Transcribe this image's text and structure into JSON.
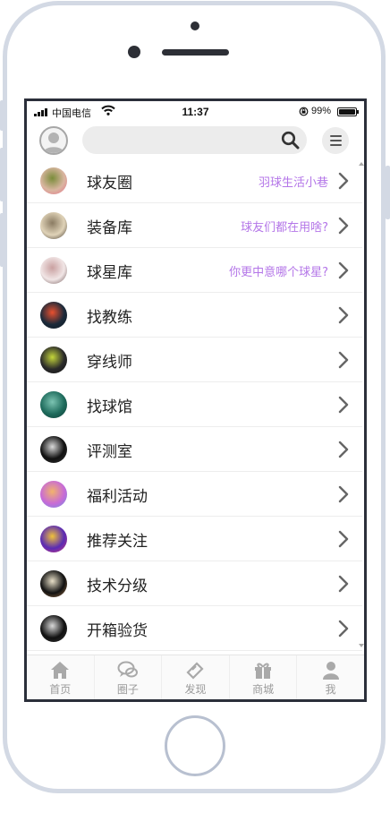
{
  "status_bar": {
    "carrier": "中国电信",
    "time": "11:37",
    "battery": "99%",
    "battery_level": 0.99
  },
  "header": {
    "search_placeholder": ""
  },
  "list": [
    {
      "label": "球友圈",
      "subtitle": "羽球生活小巷",
      "avatar_icon": "flowers-avatar",
      "avatar_colors": [
        "#d9b6a0",
        "#7a8c3a",
        "#e6708c"
      ]
    },
    {
      "label": "装备库",
      "subtitle": "球友们都在用啥?",
      "avatar_icon": "portrait-avatar",
      "avatar_colors": [
        "#e0d3b8",
        "#8a7b62",
        "#3a3128"
      ]
    },
    {
      "label": "球星库",
      "subtitle": "你更中意哪个球星?",
      "avatar_icon": "girl-avatar",
      "avatar_colors": [
        "#f1e6e6",
        "#c9a0a0",
        "#6b5252"
      ]
    },
    {
      "label": "找教练",
      "subtitle": "",
      "avatar_icon": "sunset-avatar",
      "avatar_colors": [
        "#1b2a3a",
        "#e9502f",
        "#0f1822"
      ]
    },
    {
      "label": "穿线师",
      "subtitle": "",
      "avatar_icon": "car-avatar",
      "avatar_colors": [
        "#2a2a2a",
        "#c4d63a",
        "#111111"
      ]
    },
    {
      "label": "找球馆",
      "subtitle": "",
      "avatar_icon": "ocean-avatar",
      "avatar_colors": [
        "#1e6b5c",
        "#7cc4b2",
        "#0e3a34"
      ]
    },
    {
      "label": "评测室",
      "subtitle": "",
      "avatar_icon": "arch-avatar",
      "avatar_colors": [
        "#111111",
        "#d9d9d9",
        "#333333"
      ]
    },
    {
      "label": "福利活动",
      "subtitle": "",
      "avatar_icon": "nebula-avatar",
      "avatar_colors": [
        "#c86bd6",
        "#f2b36b",
        "#6b8fe6"
      ]
    },
    {
      "label": "推荐关注",
      "subtitle": "",
      "avatar_icon": "abstract-avatar",
      "avatar_colors": [
        "#5a2bb3",
        "#f0c23a",
        "#d63a7a"
      ]
    },
    {
      "label": "技术分级",
      "subtitle": "",
      "avatar_icon": "figures-avatar",
      "avatar_colors": [
        "#111111",
        "#e8e0c8",
        "#a0744a"
      ]
    },
    {
      "label": "开箱验货",
      "subtitle": "",
      "avatar_icon": "arch-avatar",
      "avatar_colors": [
        "#111111",
        "#d9d9d9",
        "#333333"
      ]
    }
  ],
  "tabs": [
    {
      "label": "首页",
      "icon": "home-icon"
    },
    {
      "label": "圈子",
      "icon": "chat-bubbles-icon"
    },
    {
      "label": "发现",
      "icon": "ticket-icon"
    },
    {
      "label": "商城",
      "icon": "gift-icon"
    },
    {
      "label": "我",
      "icon": "person-icon"
    }
  ],
  "colors": {
    "accent_purple": "#b476e8",
    "tab_gray": "#9a9a9a",
    "frame": "#d3d9e4"
  }
}
